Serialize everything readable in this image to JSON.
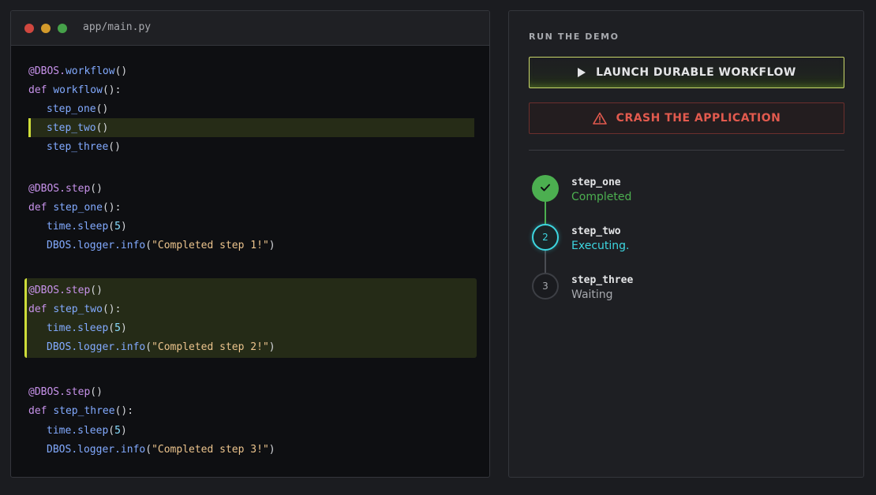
{
  "editor": {
    "filename": "app/main.py",
    "blocks": {
      "workflow": {
        "decorator_prefix": "@DBOS.",
        "decorator_name": "workflow",
        "def_kw": "def",
        "func": "workflow",
        "calls": [
          "step_one",
          "step_two",
          "step_three"
        ]
      },
      "step_one": {
        "decorator": "@DBOS.step",
        "func": "step_one",
        "sleep_arg": "5",
        "message": "\"Completed step 1!\""
      },
      "step_two": {
        "decorator": "@DBOS.step",
        "func": "step_two",
        "sleep_arg": "5",
        "message": "\"Completed step 2!\""
      },
      "step_three": {
        "decorator": "@DBOS.step",
        "func": "step_three",
        "sleep_arg": "5",
        "message": "\"Completed step 3!\""
      }
    },
    "tokens": {
      "def": "def",
      "time_sleep": "time.sleep",
      "dbos_prefix": "DBOS",
      "logger_info": ".logger.info",
      "parens": "()",
      "colon_parens": "():"
    }
  },
  "panel": {
    "section_title": "RUN THE DEMO",
    "launch_button": "LAUNCH DURABLE WORKFLOW",
    "crash_button": "CRASH THE APPLICATION",
    "launch_icon": "play-icon",
    "crash_icon": "warning-icon",
    "steps": [
      {
        "name": "step_one",
        "status": "Completed",
        "marker": "check-icon"
      },
      {
        "name": "step_two",
        "status": "Executing.",
        "marker": "2"
      },
      {
        "name": "step_three",
        "status": "Waiting",
        "marker": "3"
      }
    ]
  },
  "colors": {
    "accent_lime": "#cddc39",
    "completed_green": "#4caf50",
    "executing_cyan": "#3dd6e0",
    "crash_red": "#e25a4e"
  }
}
